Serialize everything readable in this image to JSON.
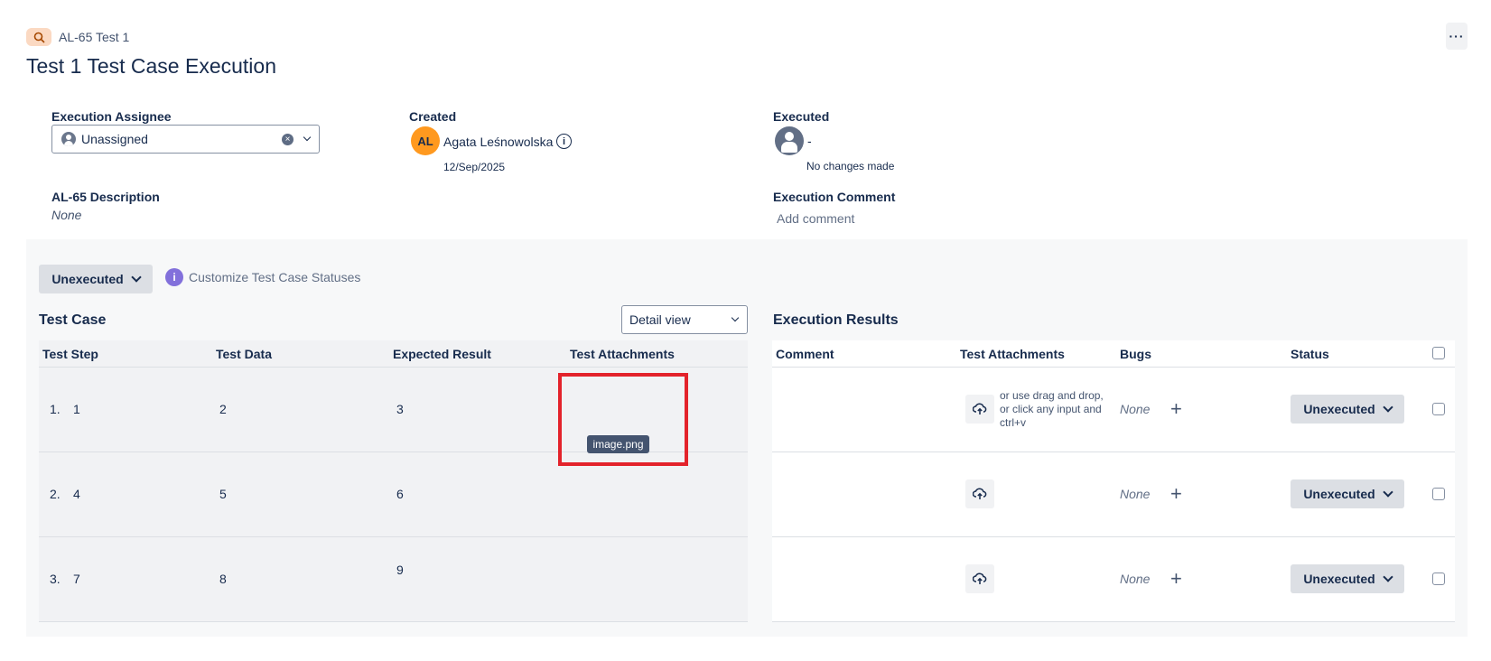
{
  "header": {
    "issue_key": "AL-65 Test 1",
    "title": "Test 1 Test Case Execution",
    "more_label": "···"
  },
  "details": {
    "assignee_label": "Execution Assignee",
    "assignee_value": "Unassigned",
    "created_label": "Created",
    "creator_initials": "AL",
    "creator_name": "Agata Leśnowolska",
    "created_date": "12/Sep/2025",
    "executed_label": "Executed",
    "executed_value": "-",
    "executed_note": "No changes made",
    "description_label": "AL-65 Description",
    "description_value": "None",
    "comment_label": "Execution Comment",
    "comment_placeholder": "Add comment"
  },
  "toolbar": {
    "status_label": "Unexecuted",
    "customize_label": "Customize Test Case Statuses",
    "info_glyph": "i"
  },
  "test_case": {
    "title": "Test Case",
    "view_select": "Detail view",
    "columns": [
      "Test Step",
      "Test Data",
      "Expected Result",
      "Test Attachments"
    ],
    "rows": [
      {
        "num": "1.",
        "step": "1",
        "data": "2",
        "expected": "3"
      },
      {
        "num": "2.",
        "step": "4",
        "data": "5",
        "expected": "6"
      },
      {
        "num": "3.",
        "step": "7",
        "data": "8",
        "expected": "9"
      }
    ],
    "attachment_name": "image.png"
  },
  "execution": {
    "title": "Execution Results",
    "columns": [
      "Comment",
      "Test Attachments",
      "Bugs",
      "Status"
    ],
    "drop_hint": "or use drag and drop, or click any input and ctrl+v",
    "rows": [
      {
        "bugs": "None",
        "status": "Unexecuted"
      },
      {
        "bugs": "None",
        "status": "Unexecuted"
      },
      {
        "bugs": "None",
        "status": "Unexecuted"
      }
    ]
  },
  "icons": {
    "issue_type": "search-icon",
    "upload": "cloud-upload-icon",
    "clear": "clear-icon",
    "info": "info-icon"
  },
  "colors": {
    "issue_badge": "#fbd9c2",
    "avatar": "#ff991f",
    "highlight_box": "#e3232b",
    "purple_info": "#8270db"
  }
}
